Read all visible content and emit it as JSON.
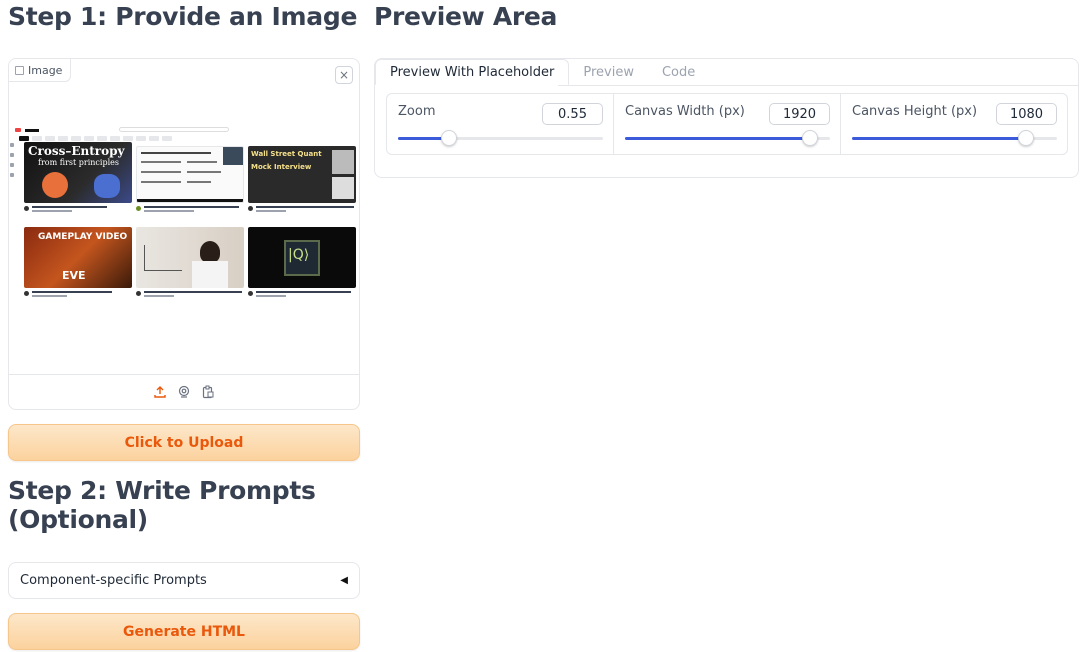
{
  "step1": {
    "title": "Step 1: Provide an Image"
  },
  "preview": {
    "title": "Preview Area"
  },
  "image_panel": {
    "label": "Image",
    "close": "×",
    "thumbs": [
      {
        "text1": "Cross–Entropy",
        "text2": "from first principles"
      },
      {
        "text1": ""
      },
      {
        "text1": "Wall Street Quant",
        "text2": "Mock Interview"
      },
      {
        "text1": "GAMEPLAY VIDEO",
        "text2": "EVE"
      },
      {
        "text1": ""
      },
      {
        "text1": "|Q⟩"
      }
    ]
  },
  "upload_button": "Click to Upload",
  "step2": {
    "title_line1": "Step 2: Write Prompts",
    "title_line2": "(Optional)"
  },
  "accordion": {
    "label": "Component-specific Prompts",
    "caret": "◀"
  },
  "generate_button": "Generate HTML",
  "tabs": [
    {
      "label": "Preview With Placeholder",
      "active": true
    },
    {
      "label": "Preview",
      "active": false
    },
    {
      "label": "Code",
      "active": false
    }
  ],
  "sliders": {
    "zoom": {
      "label": "Zoom",
      "value": "0.55",
      "fraction": 0.25
    },
    "width": {
      "label": "Canvas Width (px)",
      "value": "1920",
      "fraction": 0.9
    },
    "height": {
      "label": "Canvas Height (px)",
      "value": "1080",
      "fraction": 0.85
    }
  },
  "colors": {
    "accent": "#3b5bdb",
    "button_text": "#ea580c",
    "button_bg": "#fcd9a8"
  }
}
